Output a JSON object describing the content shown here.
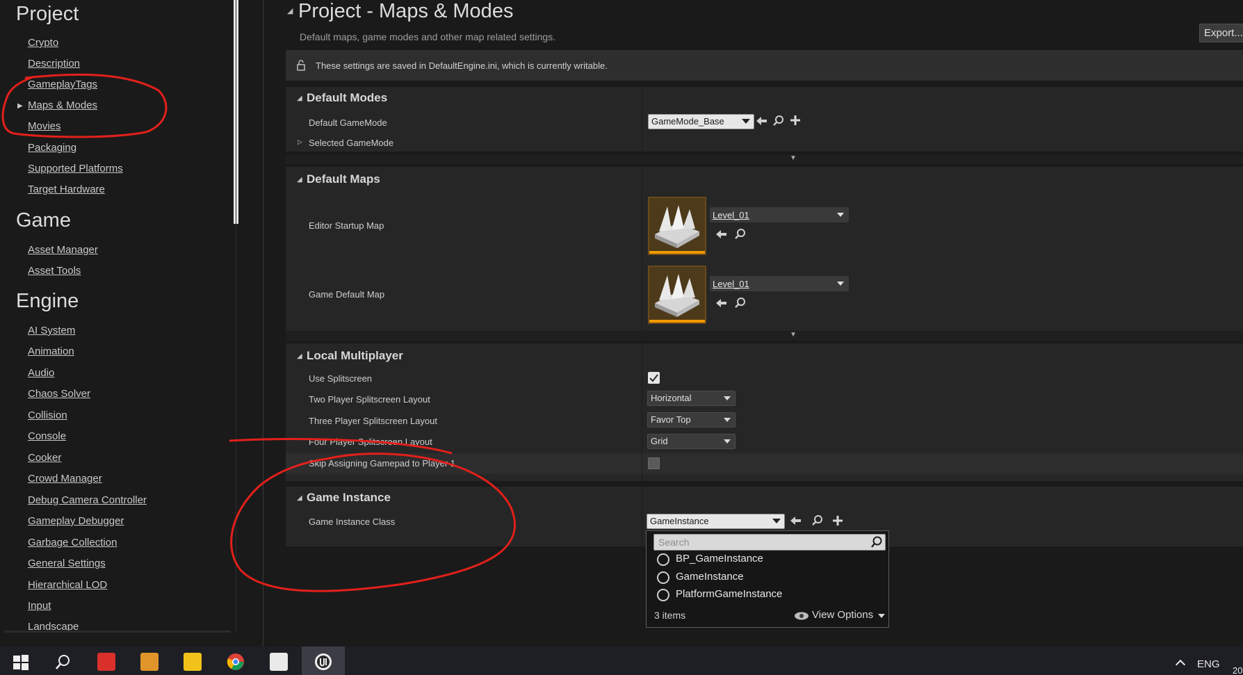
{
  "sidebar": {
    "sections": [
      {
        "title": "Project",
        "items": [
          "Crypto",
          "Description",
          "GameplayTags",
          "Maps & Modes",
          "Movies",
          "Packaging",
          "Supported Platforms",
          "Target Hardware"
        ]
      },
      {
        "title": "Game",
        "items": [
          "Asset Manager",
          "Asset Tools"
        ]
      },
      {
        "title": "Engine",
        "items": [
          "AI System",
          "Animation",
          "Audio",
          "Chaos Solver",
          "Collision",
          "Console",
          "Cooker",
          "Crowd Manager",
          "Debug Camera Controller",
          "Gameplay Debugger",
          "Garbage Collection",
          "General Settings",
          "Hierarchical LOD",
          "Input",
          "Landscape"
        ]
      }
    ],
    "selected_item": "Maps & Modes"
  },
  "main": {
    "title": "Project - Maps & Modes",
    "subtitle": "Default maps, game modes and other map related settings.",
    "export_label": "Export...",
    "notice": "These settings are saved in DefaultEngine.ini, which is currently writable."
  },
  "default_modes": {
    "header": "Default Modes",
    "default_gamemode_label": "Default GameMode",
    "default_gamemode_value": "GameMode_Base",
    "selected_gamemode_label": "Selected GameMode"
  },
  "default_maps": {
    "header": "Default Maps",
    "editor_startup_label": "Editor Startup Map",
    "editor_startup_value": "Level_01",
    "game_default_label": "Game Default Map",
    "game_default_value": "Level_01"
  },
  "local_multiplayer": {
    "header": "Local Multiplayer",
    "use_splitscreen_label": "Use Splitscreen",
    "use_splitscreen_checked": true,
    "two_player_label": "Two Player Splitscreen Layout",
    "two_player_value": "Horizontal",
    "three_player_label": "Three Player Splitscreen Layout",
    "three_player_value": "Favor Top",
    "four_player_label": "Four Player Splitscreen Layout",
    "four_player_value": "Grid",
    "skip_gamepad_label": "Skip Assigning Gamepad to Player 1",
    "skip_gamepad_checked": false
  },
  "game_instance": {
    "header": "Game Instance",
    "class_label": "Game Instance Class",
    "class_value": "GameInstance",
    "search_placeholder": "Search",
    "options": [
      "BP_GameInstance",
      "GameInstance",
      "PlatformGameInstance"
    ],
    "count_label": "3 items",
    "view_options_label": "View Options"
  },
  "taskbar": {
    "lang": "ENG",
    "time_fragment": "20"
  },
  "colors": {
    "annotation": "#e3201b",
    "accent": "#f39a00"
  }
}
